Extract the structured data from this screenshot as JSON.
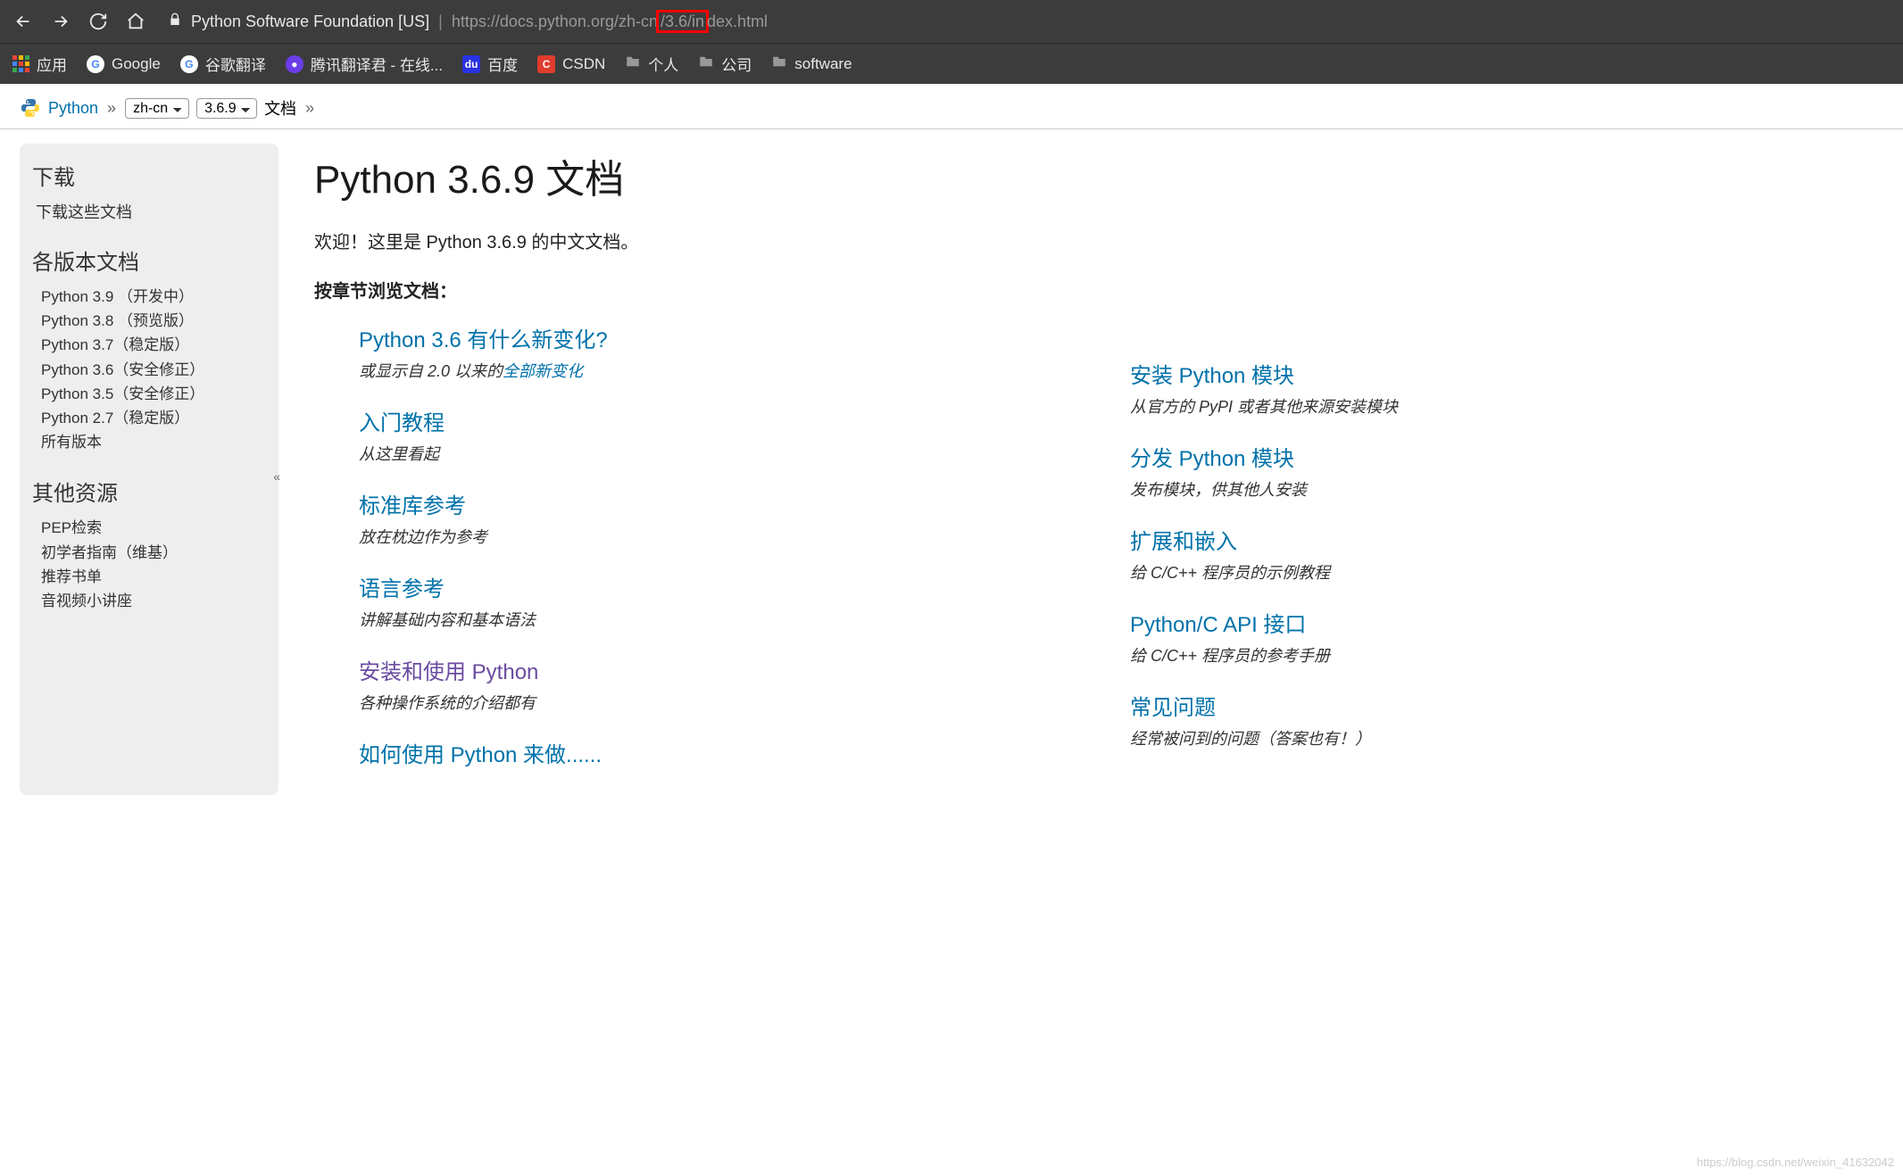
{
  "browser": {
    "org": "Python Software Foundation [US]",
    "url_prefix": "https://docs.python.org/zh-cn",
    "url_boxed": "/3.6/in",
    "url_suffix": "dex.html"
  },
  "bookmarks": {
    "apps": "应用",
    "google": "Google",
    "gtranslate": "谷歌翻译",
    "tencent": "腾讯翻译君 - 在线...",
    "baidu": "百度",
    "csdn": "CSDN",
    "personal": "个人",
    "company": "公司",
    "software": "software"
  },
  "topnav": {
    "python": "Python",
    "lang": "zh-cn",
    "version": "3.6.9",
    "docs": "文档"
  },
  "sidebar": {
    "download_hdr": "下载",
    "download_sub": "下载这些文档",
    "versions_hdr": "各版本文档",
    "versions": [
      "Python 3.9 （开发中）",
      "Python 3.8 （预览版）",
      "Python 3.7（稳定版）",
      "Python 3.6（安全修正）",
      "Python 3.5（安全修正）",
      "Python 2.7（稳定版）",
      "所有版本"
    ],
    "other_hdr": "其他资源",
    "other": [
      "PEP检索",
      "初学者指南（维基）",
      "推荐书单",
      "音视频小讲座"
    ]
  },
  "main": {
    "title": "Python 3.6.9 文档",
    "welcome": "欢迎！这里是 Python 3.6.9 的中文文档。",
    "browse": "按章节浏览文档：",
    "left": [
      {
        "title": "Python 3.6 有什么新变化?",
        "desc_pre": "或显示自 2.0 以来的",
        "desc_link": "全部新变化",
        "visited": false
      },
      {
        "title": "入门教程",
        "desc": "从这里看起",
        "visited": false
      },
      {
        "title": "标准库参考",
        "desc": "放在枕边作为参考",
        "visited": false
      },
      {
        "title": "语言参考",
        "desc": "讲解基础内容和基本语法",
        "visited": false
      },
      {
        "title": "安装和使用 Python",
        "desc": "各种操作系统的介绍都有",
        "visited": true
      },
      {
        "title": "如何使用 Python 来做......",
        "desc": "",
        "visited": false
      }
    ],
    "right": [
      {
        "title": "安装 Python 模块",
        "desc": "从官方的 PyPI 或者其他来源安装模块"
      },
      {
        "title": "分发 Python 模块",
        "desc": "发布模块，供其他人安装"
      },
      {
        "title": "扩展和嵌入",
        "desc": "给 C/C++ 程序员的示例教程"
      },
      {
        "title": "Python/C API 接口",
        "desc": "给 C/C++ 程序员的参考手册"
      },
      {
        "title": "常见问题",
        "desc": "经常被问到的问题（答案也有！）"
      }
    ]
  },
  "watermark": "https://blog.csdn.net/weixin_41632042"
}
